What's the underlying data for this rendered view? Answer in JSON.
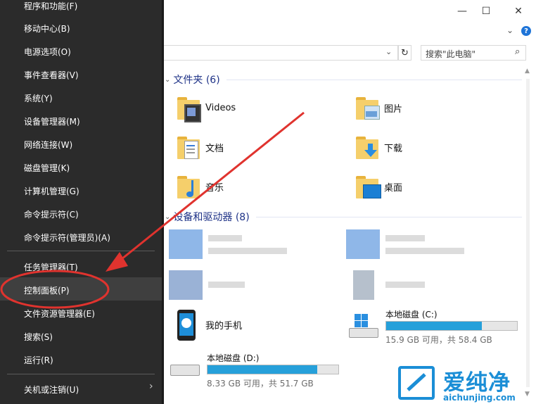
{
  "menu": {
    "items": [
      {
        "label": "程序和功能(F)"
      },
      {
        "label": "移动中心(B)"
      },
      {
        "label": "电源选项(O)"
      },
      {
        "label": "事件查看器(V)"
      },
      {
        "label": "系统(Y)"
      },
      {
        "label": "设备管理器(M)"
      },
      {
        "label": "网络连接(W)"
      },
      {
        "label": "磁盘管理(K)"
      },
      {
        "label": "计算机管理(G)"
      },
      {
        "label": "命令提示符(C)"
      },
      {
        "label": "命令提示符(管理员)(A)"
      },
      {
        "label": "任务管理器(T)"
      },
      {
        "label": "控制面板(P)"
      },
      {
        "label": "文件资源管理器(E)"
      },
      {
        "label": "搜索(S)"
      },
      {
        "label": "运行(R)"
      },
      {
        "label": "关机或注销(U)"
      }
    ],
    "submenu_arrow": "›"
  },
  "explorer": {
    "window": {
      "minimize": "—",
      "maximize": "☐",
      "close": "✕",
      "help": "?",
      "expand": "⌄"
    },
    "address": {
      "dropdown": "⌄",
      "refresh": "↻"
    },
    "search": {
      "placeholder": "搜索\"此电脑\"",
      "icon": "search-icon"
    },
    "folders_section": "文件夹 (6)",
    "folders": [
      {
        "label": "Videos",
        "icon": "videos-folder-icon"
      },
      {
        "label": "图片",
        "icon": "pictures-folder-icon"
      },
      {
        "label": "文档",
        "icon": "documents-folder-icon"
      },
      {
        "label": "下载",
        "icon": "downloads-folder-icon"
      },
      {
        "label": "音乐",
        "icon": "music-folder-icon"
      },
      {
        "label": "桌面",
        "icon": "desktop-folder-icon"
      }
    ],
    "devices_section": "设备和驱动器 (8)",
    "devices": [
      {
        "label": "我的手机",
        "icon": "phone-icon"
      },
      {
        "label": "本地磁盘 (C:)",
        "detail": "15.9 GB 可用，共 58.4 GB",
        "used_fraction": 0.73,
        "icon": "windows-drive-icon"
      },
      {
        "label": "本地磁盘 (D:)",
        "detail": "8.33 GB 可用，共 51.7 GB",
        "used_fraction": 0.84,
        "icon": "drive-icon"
      }
    ]
  },
  "annotation": {
    "arrow_color": "#e0332e"
  },
  "watermark": {
    "brand": "爱纯净",
    "url": "aichunjing.com"
  },
  "colors": {
    "menu_bg": "#2b2b2b",
    "drive_fill": "#26a0da",
    "section_title": "#1e3287"
  }
}
